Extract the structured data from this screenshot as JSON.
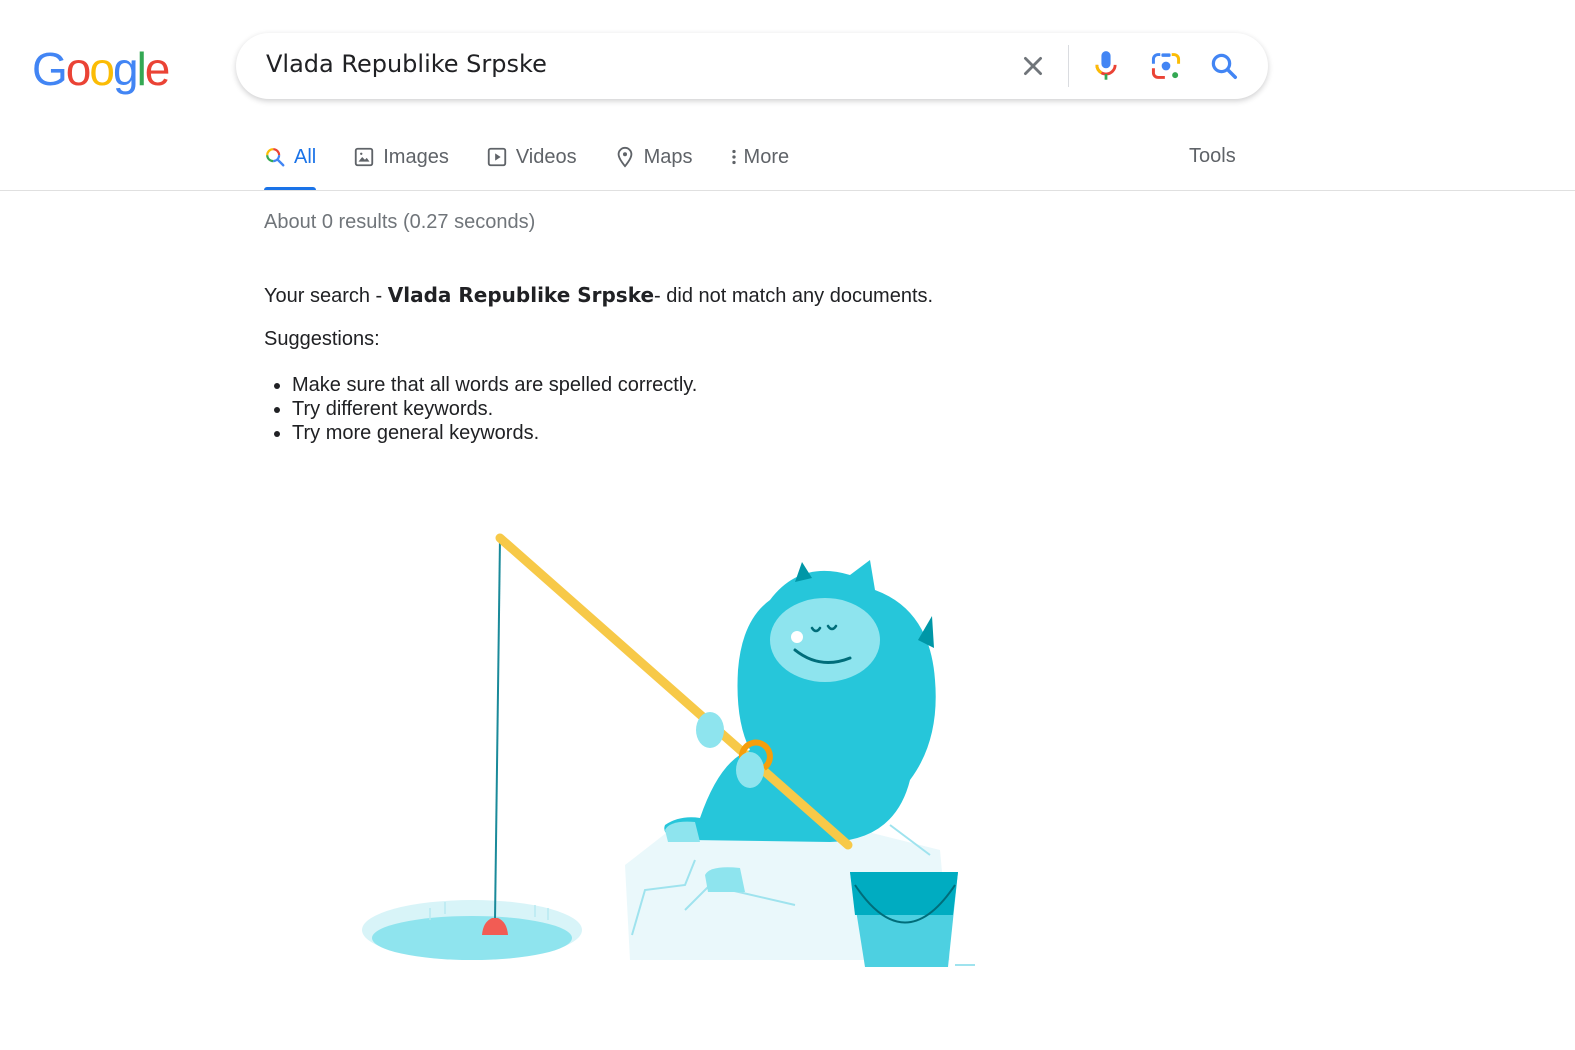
{
  "logo": {
    "letters": [
      "G",
      "o",
      "o",
      "g",
      "l",
      "e"
    ],
    "colors": [
      "#4285f4",
      "#ea4335",
      "#fbbc05",
      "#4285f4",
      "#34a853",
      "#ea4335"
    ]
  },
  "search": {
    "query": "Vlada Republike Srpske",
    "placeholder": ""
  },
  "tabs": [
    {
      "label": "All",
      "icon": "search-icon",
      "active": true
    },
    {
      "label": "Images",
      "icon": "image-icon",
      "active": false
    },
    {
      "label": "Videos",
      "icon": "video-icon",
      "active": false
    },
    {
      "label": "Maps",
      "icon": "map-pin-icon",
      "active": false
    },
    {
      "label": "More",
      "icon": "more-vert-icon",
      "active": false
    }
  ],
  "tools_label": "Tools",
  "result_stats": "About 0 results (0.27 seconds)",
  "no_match": {
    "prefix": "Your search - ",
    "query": "Vlada Republike Srpske",
    "suffix": "- did not match any documents."
  },
  "suggestions": {
    "title": "Suggestions:",
    "items": [
      "Make sure that all words are spelled correctly.",
      "Try different keywords.",
      "Try more general keywords."
    ]
  },
  "colors": {
    "accent": "#1a73e8",
    "muted": "#70757a",
    "tab_text": "#5f6368",
    "yeti": "#26c6da"
  }
}
